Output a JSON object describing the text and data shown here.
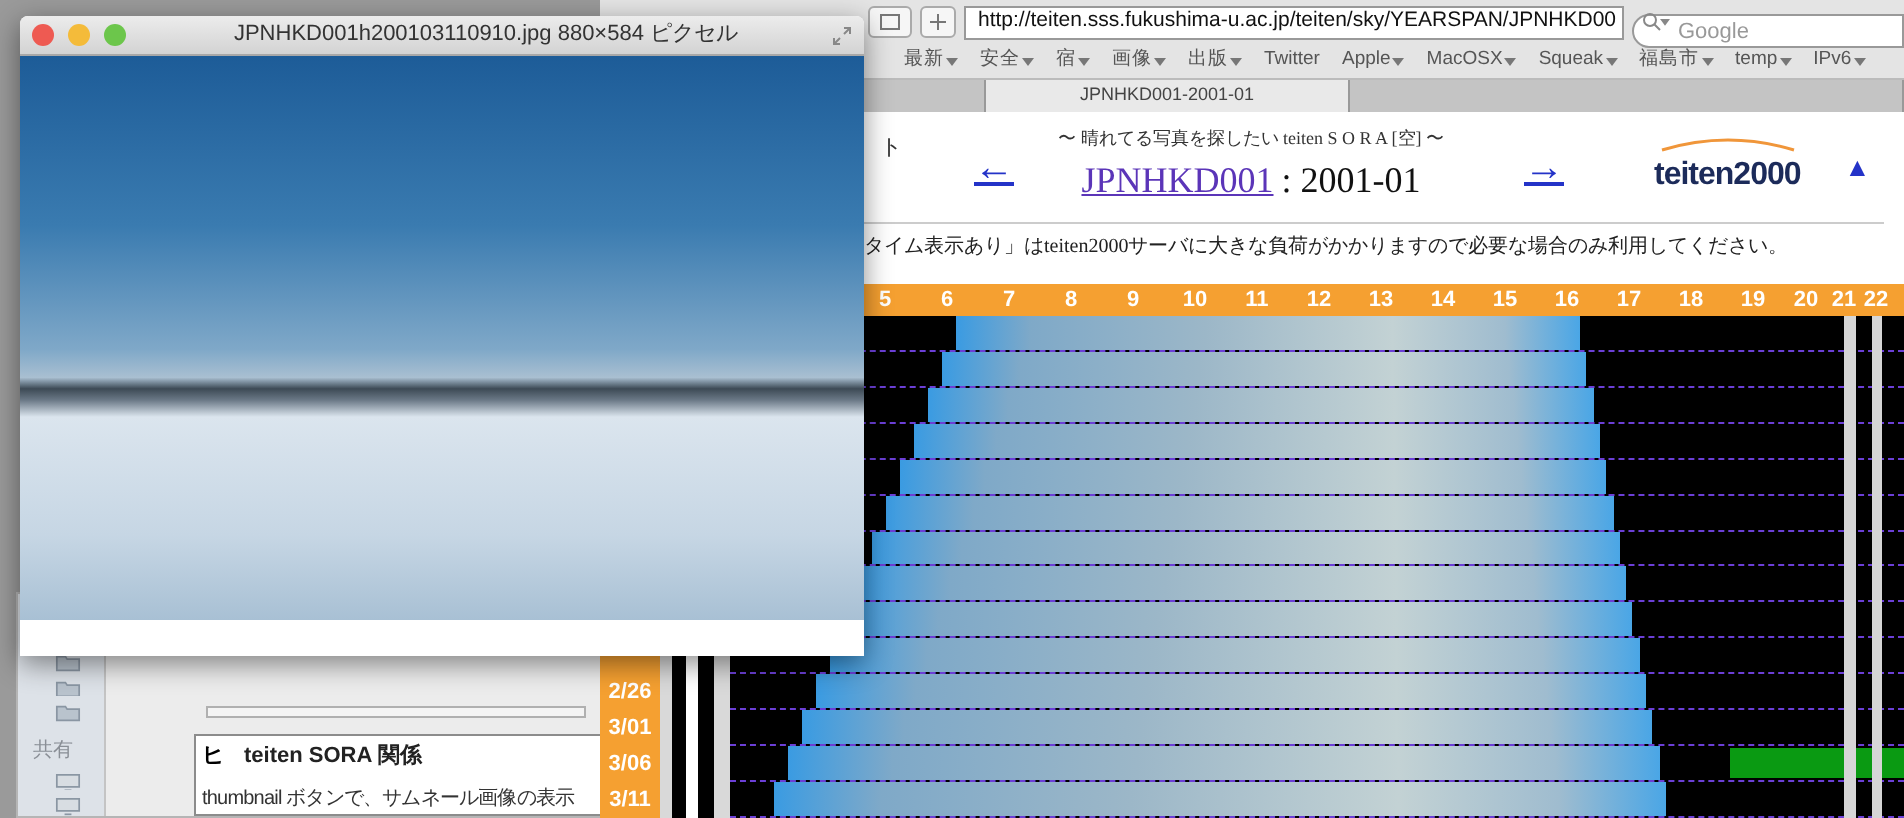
{
  "image_window": {
    "title": "JPNHKD001h200103110910.jpg 880×584 ピクセル"
  },
  "back_window": {
    "sidebar_heading": "共有",
    "document": {
      "marker": "ヒ",
      "heading": "teiten SORA 関係",
      "body": "thumbnail ボタンで、サムネール画像の表示"
    }
  },
  "browser": {
    "url": "http://teiten.sss.fukushima-u.ac.jp/teiten/sky/YEARSPAN/JPNHKD00",
    "search_placeholder": "Google",
    "bookmarks": [
      {
        "label": "最新",
        "menu": true
      },
      {
        "label": "安全",
        "menu": true
      },
      {
        "label": "宿",
        "menu": true
      },
      {
        "label": "画像",
        "menu": true
      },
      {
        "label": "出版",
        "menu": true
      },
      {
        "label": "Twitter",
        "menu": false
      },
      {
        "label": "Apple",
        "menu": true
      },
      {
        "label": "MacOSX",
        "menu": true
      },
      {
        "label": "Squeak",
        "menu": true
      },
      {
        "label": "福島市",
        "menu": true
      },
      {
        "label": "temp",
        "menu": true
      },
      {
        "label": "IPv6",
        "menu": true
      }
    ],
    "tabs": [
      {
        "selected": false
      },
      {
        "label": "JPNHKD001-2001-01",
        "selected": true
      },
      {
        "selected": false
      }
    ]
  },
  "page": {
    "heading_tail": "ト",
    "subtitle": "〜 晴れてる写真を探したい teiten S O R A [空] 〜",
    "prev": "←",
    "station_link": "JPNHKD001",
    "period": ": 2001-01",
    "next": "→",
    "logo": "teiten2000",
    "top_link": "▲",
    "notice": "タイム表示あり」はteiten2000サーバに大きな負荷がかかりますので必要な場合のみ利用してください。",
    "hours": [
      "5",
      "6",
      "7",
      "8",
      "9",
      "10",
      "11",
      "12",
      "13",
      "14",
      "15",
      "16",
      "17",
      "18",
      "19",
      "20",
      "21",
      "22"
    ],
    "dates": [
      "2/26",
      "3/01",
      "3/06",
      "3/11"
    ]
  }
}
